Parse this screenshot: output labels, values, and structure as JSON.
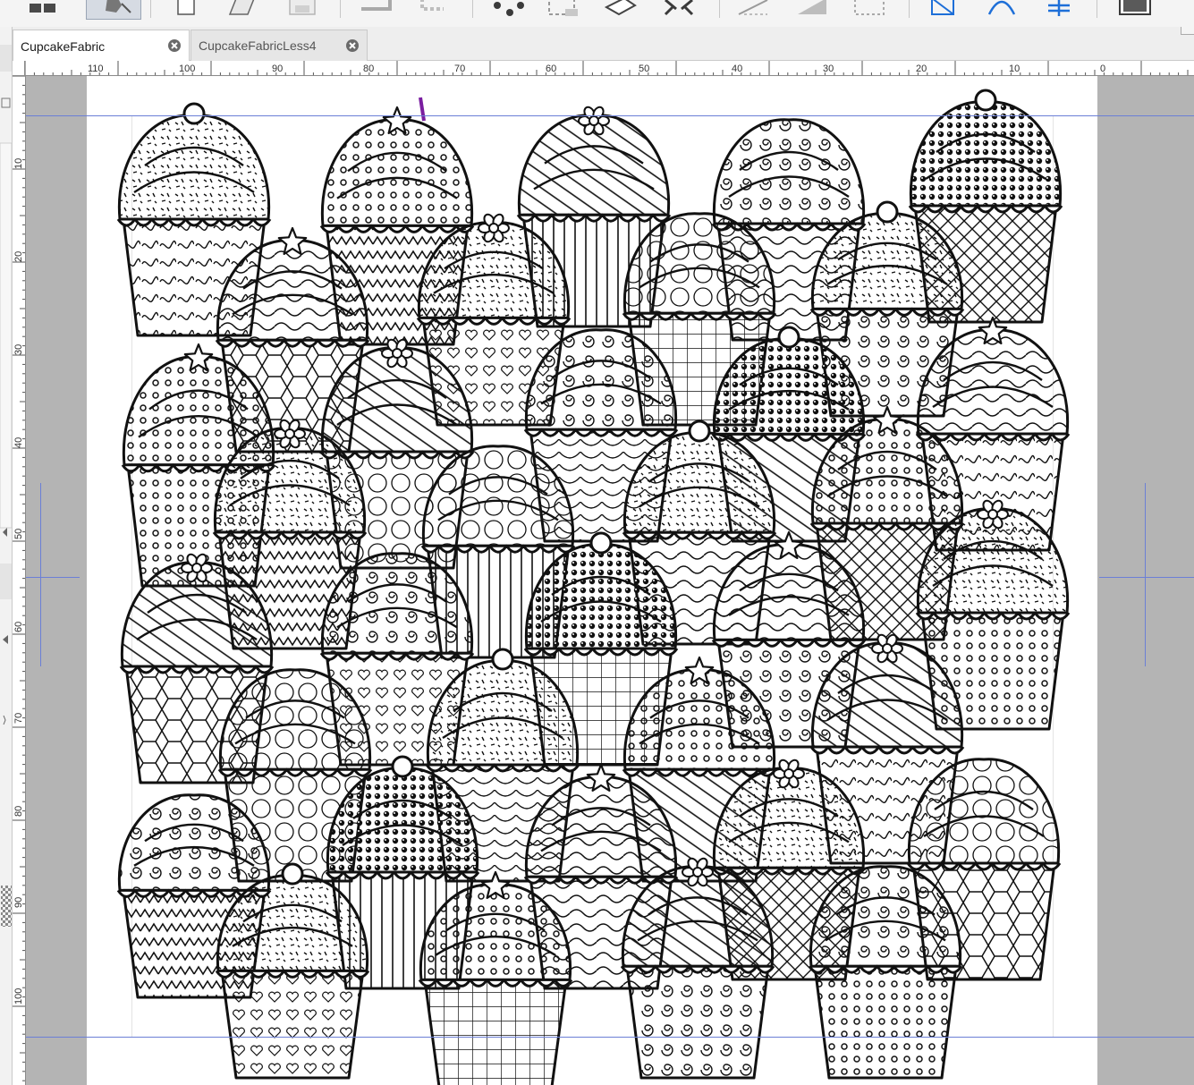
{
  "tabs": [
    {
      "label": "CupcakeFabric",
      "active": true
    },
    {
      "label": "CupcakeFabricLess4",
      "active": false
    }
  ],
  "toolbar": {
    "buttons": [
      "layout-icon",
      "select-tool-icon",
      "new-page-icon",
      "page-setup-icon",
      "save-icon",
      "undo-icon",
      "redo-icon",
      "scatter-icon",
      "crop-icon",
      "eraser-icon",
      "expand-icon",
      "slant-icon",
      "trim-icon",
      "grid-icon",
      "bezier-node-icon",
      "arc-icon",
      "add-node-icon",
      "frame-icon"
    ]
  },
  "ruler_h": {
    "labels": [
      "110",
      "100",
      "90",
      "80",
      "70",
      "60",
      "50",
      "40",
      "30",
      "20",
      "10",
      "0"
    ]
  },
  "ruler_v": {
    "labels": [
      "10",
      "20",
      "30",
      "40",
      "50",
      "60",
      "70",
      "80",
      "90",
      "100"
    ]
  },
  "canvas": {
    "content": "cupcake-line-art",
    "colors": {
      "page": "#ffffff",
      "pasteboard": "#b4b4b4",
      "ink": "#111111",
      "guide": "#6b7fd6",
      "selected_node": "#7a1ea0"
    }
  }
}
